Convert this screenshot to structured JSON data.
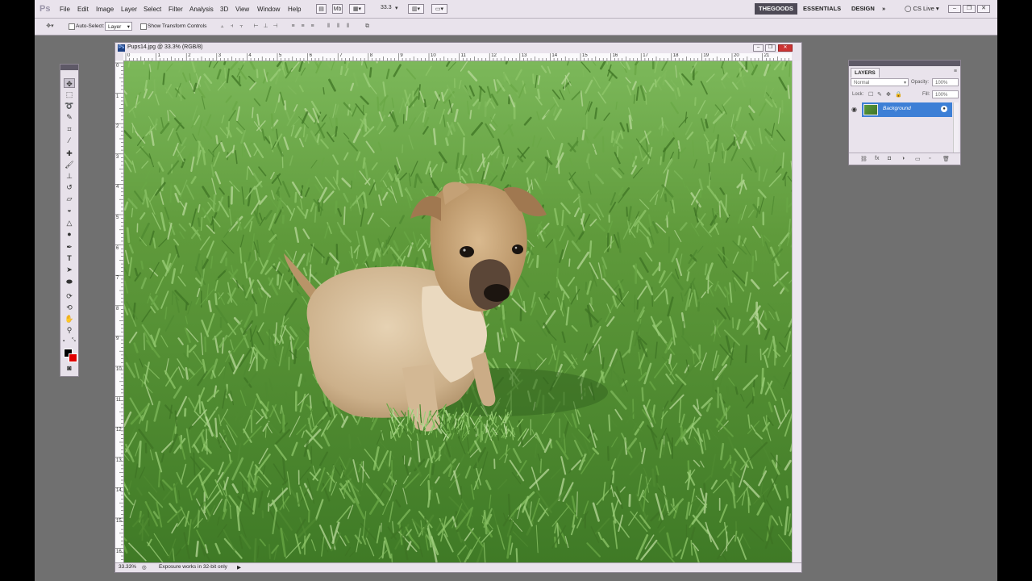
{
  "app": {
    "logo": "Ps",
    "menus": [
      "File",
      "Edit",
      "Image",
      "Layer",
      "Select",
      "Filter",
      "Analysis",
      "3D",
      "View",
      "Window",
      "Help"
    ],
    "zoom_field": "33.3",
    "workspaces": [
      "THEGOODS",
      "ESSENTIALS",
      "DESIGN"
    ],
    "active_workspace": "THEGOODS",
    "more_workspaces": "»",
    "cs_live": "CS Live"
  },
  "options_bar": {
    "auto_select_label": "Auto-Select:",
    "auto_select_value": "Layer",
    "show_transform_label": "Show Transform Controls"
  },
  "document": {
    "title": "Pups14.jpg @ 33.3% (RGB/8)",
    "ruler_h": [
      "0",
      "1",
      "2",
      "3",
      "4",
      "5",
      "6",
      "7",
      "8",
      "9",
      "10",
      "11",
      "12",
      "13",
      "14",
      "15",
      "16",
      "17",
      "18",
      "19",
      "20",
      "21"
    ],
    "ruler_v": [
      "0",
      "1",
      "2",
      "3",
      "4",
      "5",
      "6",
      "7",
      "8",
      "9",
      "10",
      "11",
      "12",
      "13",
      "14",
      "15",
      "16"
    ],
    "status_zoom": "33.33%",
    "status_info": "Exposure works in 32-bit only"
  },
  "layers_panel": {
    "tab": "LAYERS",
    "blend_mode": "Normal",
    "opacity_label": "Opacity:",
    "opacity_value": "100%",
    "lock_label": "Lock:",
    "fill_label": "Fill:",
    "fill_value": "100%",
    "layer_name": "Background"
  },
  "colors": {
    "foreground": "#000000",
    "background": "#e00000",
    "selected_layer": "#3d7fd6"
  }
}
